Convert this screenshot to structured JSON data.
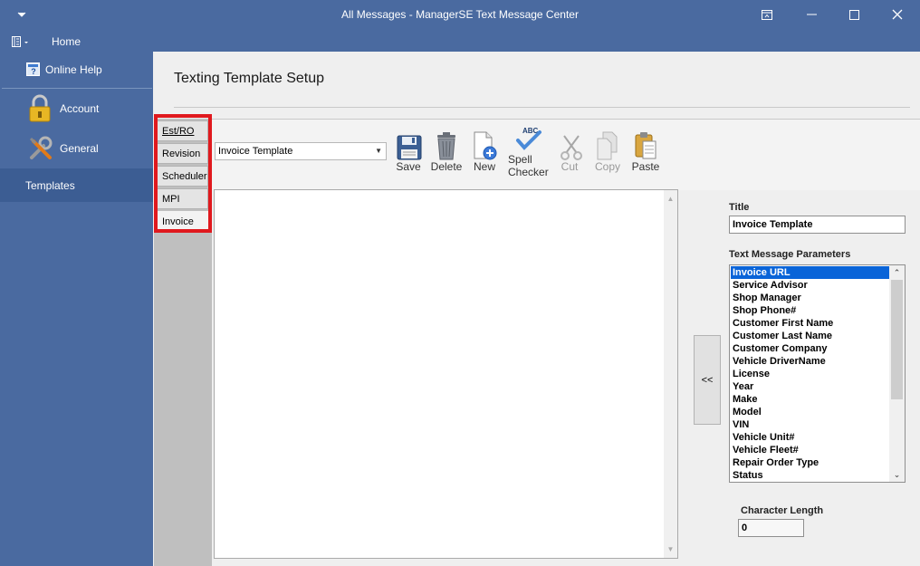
{
  "window": {
    "title": "All Messages - ManagerSE Text Message Center"
  },
  "sidebar": {
    "home_label": "Home",
    "online_help_label": "Online Help",
    "items": [
      {
        "label": "Account",
        "icon": "lock-icon"
      },
      {
        "label": "General",
        "icon": "tools-icon"
      },
      {
        "label": "Templates",
        "icon": ""
      }
    ],
    "active": "Templates"
  },
  "main": {
    "page_title": "Texting Template Setup",
    "tabs": [
      {
        "label": "Est/RO"
      },
      {
        "label": "Revision"
      },
      {
        "label": "Scheduler"
      },
      {
        "label": "MPI"
      },
      {
        "label": "Invoice"
      }
    ],
    "active_tab": "Invoice",
    "template_select": {
      "value": "Invoice Template"
    },
    "toolbar": {
      "save": "Save",
      "delete": "Delete",
      "new": "New",
      "spell_line1": "Spell",
      "spell_line2": "Checker",
      "spell_icon_text": "ABC",
      "cut": "Cut",
      "copy": "Copy",
      "paste": "Paste"
    },
    "editor_text": "",
    "insert_button": "<<"
  },
  "right_panel": {
    "title_label": "Title",
    "title_value": "Invoice Template",
    "params_label": "Text Message Parameters",
    "params": [
      "Invoice URL",
      "Service Advisor",
      "Shop Manager",
      "Shop Phone#",
      "Customer First Name",
      "Customer Last Name",
      "Customer Company",
      "Vehicle DriverName",
      "License",
      "Year",
      "Make",
      "Model",
      "VIN",
      "Vehicle Unit#",
      "Vehicle Fleet#",
      "Repair Order Type",
      "Status"
    ],
    "selected_param": "Invoice URL",
    "char_length_label": "Character Length",
    "char_length_value": "0"
  },
  "colors": {
    "chrome": "#4a6aa0",
    "highlight": "#e0191e",
    "selection": "#0a64d8"
  }
}
